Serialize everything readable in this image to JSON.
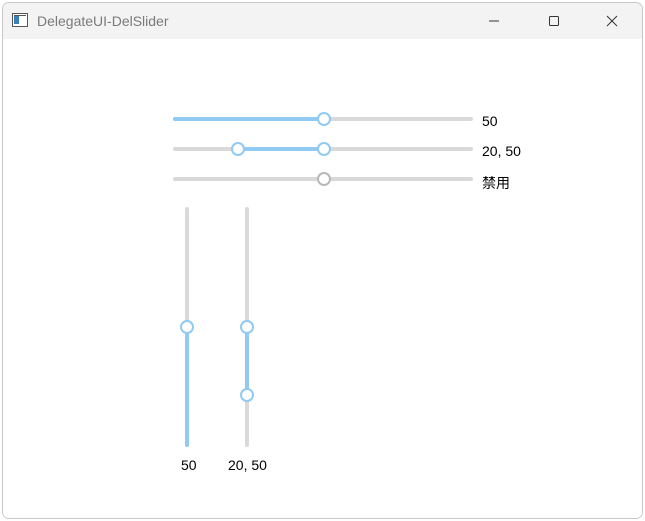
{
  "window": {
    "title": "DelegateUI-DelSlider"
  },
  "horizontal_sliders": [
    {
      "label": "50",
      "value": 50,
      "min": 0,
      "max": 100,
      "disabled": false
    },
    {
      "label": "20, 50",
      "range": [
        20,
        50
      ],
      "min": 0,
      "max": 100,
      "disabled": false
    },
    {
      "label": "禁用",
      "value": 50,
      "min": 0,
      "max": 100,
      "disabled": true
    }
  ],
  "vertical_sliders": [
    {
      "label": "50",
      "value": 50,
      "min": 0,
      "max": 100
    },
    {
      "label": "20, 50",
      "range": [
        20,
        50
      ],
      "min": 0,
      "max": 100
    }
  ],
  "colors": {
    "accent": "#91caf2",
    "track": "#d9d9d9",
    "disabled_handle": "#b8b8b8"
  }
}
